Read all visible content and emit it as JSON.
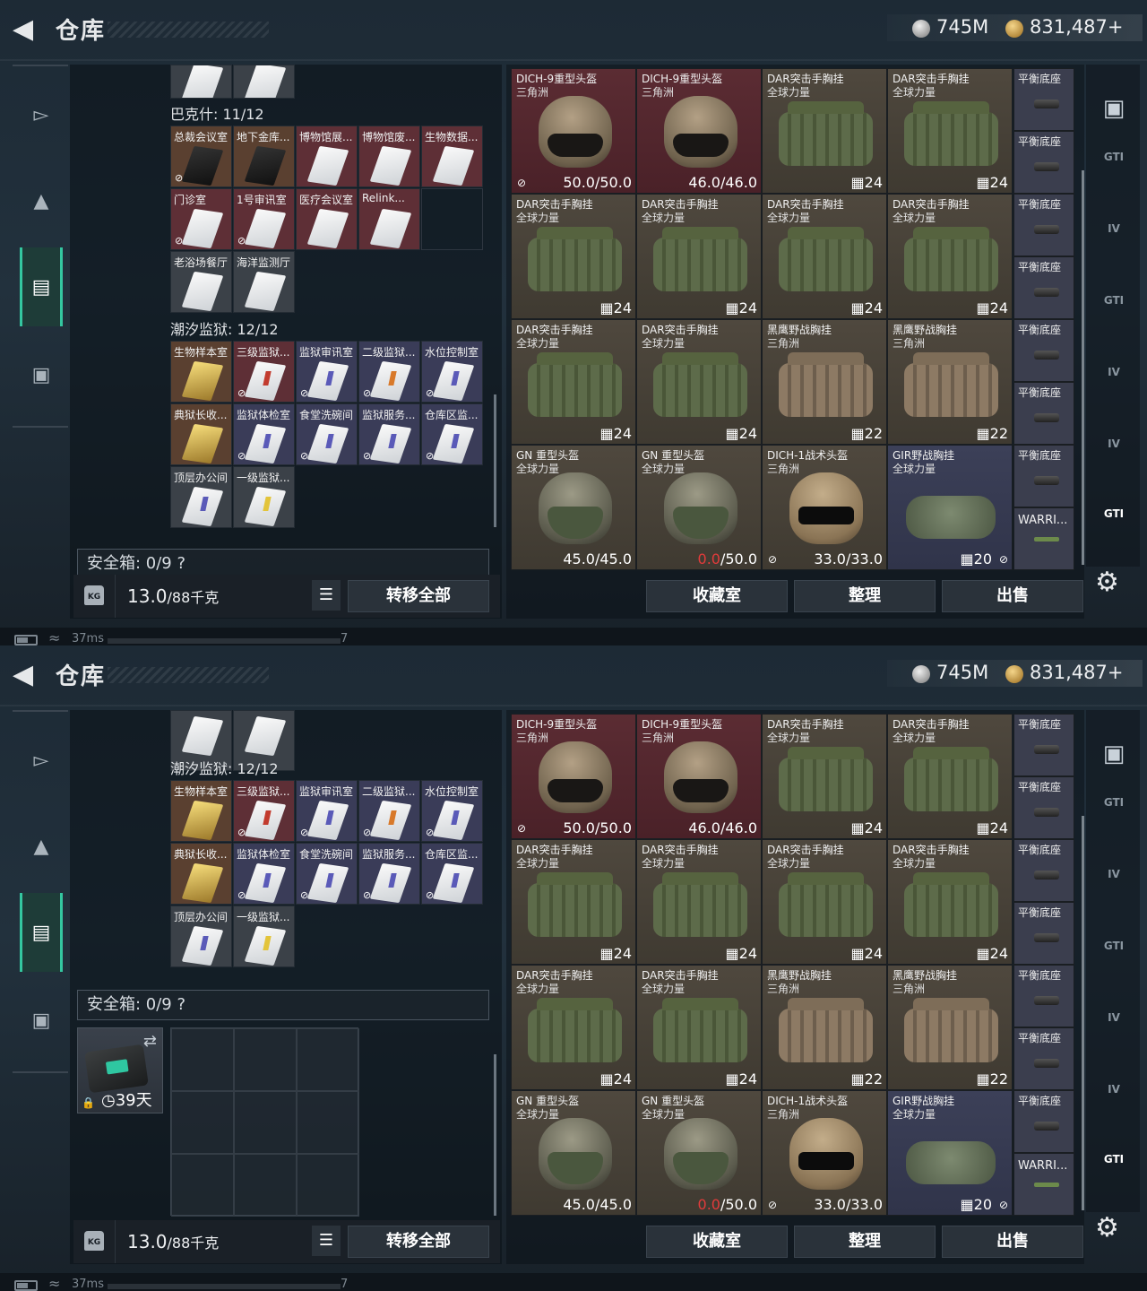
{
  "header": {
    "title": "仓库",
    "currency_silver": "745M",
    "currency_gold": "831,487+",
    "silver_icon": "silver-coin-icon",
    "gold_icon": "gold-coin-icon"
  },
  "nav": {
    "items": [
      {
        "name": "weapon",
        "icon": "pistol-icon"
      },
      {
        "name": "armor",
        "icon": "armor-icon"
      },
      {
        "name": "backpack",
        "icon": "backpack-icon",
        "active": true
      },
      {
        "name": "case",
        "icon": "briefcase-icon"
      }
    ]
  },
  "keys": {
    "group_bakesh": {
      "label": "巴克什: 11/12",
      "items": [
        "总裁会议室",
        "地下金库...",
        "博物馆展...",
        "博物馆废...",
        "生物数据...",
        "门诊室",
        "1号审讯室",
        "医疗会议室",
        "Relink...",
        "老浴场餐厅",
        "海洋监测厅"
      ]
    },
    "group_chaoxi": {
      "label": "潮汐监狱: 12/12",
      "items": [
        "生物样本室",
        "三级监狱...",
        "监狱审讯室",
        "二级监狱...",
        "水位控制室",
        "典狱长收...",
        "监狱体检室",
        "食堂洗碗间",
        "监狱服务...",
        "仓库区监...",
        "顶层办公间",
        "一级监狱..."
      ]
    }
  },
  "safe": {
    "label": "安全箱: 0/9",
    "help": "?",
    "container_days": "39天"
  },
  "weight": {
    "value": "13.0",
    "max": "/88千克",
    "kg_label": "KG"
  },
  "buttons": {
    "transfer_all": "转移全部",
    "collection": "收藏室",
    "organize": "整理",
    "sell": "出售",
    "list_icon": "☰"
  },
  "items": [
    {
      "name": "DICH-9重型头盔",
      "sub": "三角洲",
      "stat": "50.0/50.0",
      "kind": "helmet",
      "bg": "rust"
    },
    {
      "name": "DICH-9重型头盔",
      "sub": "三角洲",
      "stat": "46.0/46.0",
      "kind": "helmet",
      "bg": "rust"
    },
    {
      "name": "DAR突击手胸挂",
      "sub": "全球力量",
      "stat": "24",
      "kind": "vest",
      "bg": "olive"
    },
    {
      "name": "DAR突击手胸挂",
      "sub": "全球力量",
      "stat": "24",
      "kind": "vest",
      "bg": "olive"
    },
    {
      "name": "DAR突击手胸挂",
      "sub": "全球力量",
      "stat": "24",
      "kind": "vest",
      "bg": "olive"
    },
    {
      "name": "DAR突击手胸挂",
      "sub": "全球力量",
      "stat": "24",
      "kind": "vest",
      "bg": "olive"
    },
    {
      "name": "DAR突击手胸挂",
      "sub": "全球力量",
      "stat": "24",
      "kind": "vest",
      "bg": "olive"
    },
    {
      "name": "DAR突击手胸挂",
      "sub": "全球力量",
      "stat": "24",
      "kind": "vest",
      "bg": "olive"
    },
    {
      "name": "DAR突击手胸挂",
      "sub": "全球力量",
      "stat": "24",
      "kind": "vest",
      "bg": "olive"
    },
    {
      "name": "DAR突击手胸挂",
      "sub": "全球力量",
      "stat": "24",
      "kind": "vest",
      "bg": "olive"
    },
    {
      "name": "黑鹰野战胸挂",
      "sub": "三角洲",
      "stat": "22",
      "kind": "vest-tan",
      "bg": "olive"
    },
    {
      "name": "黑鹰野战胸挂",
      "sub": "三角洲",
      "stat": "22",
      "kind": "vest-tan",
      "bg": "olive"
    },
    {
      "name": "GN 重型头盔",
      "sub": "全球力量",
      "stat": "45.0/45.0",
      "kind": "gn",
      "bg": "olive"
    },
    {
      "name": "GN 重型头盔",
      "sub": "全球力量",
      "stat_red": "0.0",
      "stat": "/50.0",
      "kind": "gn",
      "bg": "olive"
    },
    {
      "name": "DICH-1战术头盔",
      "sub": "三角洲",
      "stat": "33.0/33.0",
      "kind": "dich1",
      "bg": "olive"
    },
    {
      "name": "GIR野战胸挂",
      "sub": "全球力量",
      "stat": "20",
      "kind": "gir",
      "bg": "navy"
    }
  ],
  "side_slots": [
    "平衡底座",
    "平衡底座",
    "平衡底座",
    "平衡底座",
    "平衡底座",
    "平衡底座",
    "平衡底座",
    "WARRI..."
  ],
  "sidebar": [
    "GTI",
    "IV",
    "GTI",
    "IV",
    "IV",
    "GTI"
  ],
  "status": {
    "ping": "37ms",
    "num": "7"
  }
}
